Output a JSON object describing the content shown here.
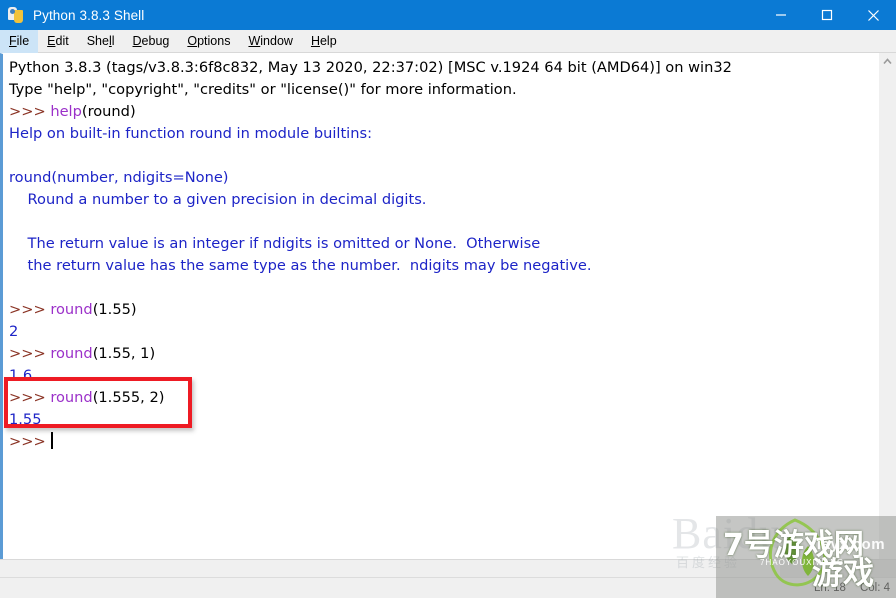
{
  "window": {
    "title": "Python 3.8.3 Shell",
    "icon": "python-logo-icon",
    "minimize_label": "—",
    "maximize_label": "□",
    "close_label": "✕"
  },
  "menubar": {
    "items": [
      {
        "label": "File",
        "accel": "F",
        "active": true
      },
      {
        "label": "Edit",
        "accel": "E",
        "active": false
      },
      {
        "label": "Shell",
        "accel": "l",
        "active": false
      },
      {
        "label": "Debug",
        "accel": "D",
        "active": false
      },
      {
        "label": "Options",
        "accel": "O",
        "active": false
      },
      {
        "label": "Window",
        "accel": "W",
        "active": false
      },
      {
        "label": "Help",
        "accel": "H",
        "active": false
      }
    ]
  },
  "console": {
    "lines": [
      {
        "segments": [
          {
            "text": "Python 3.8.3 (tags/v3.8.3:6f8c832, May 13 2020, 22:37:02) [MSC v.1924 64 bit (AMD64)] on win32",
            "style": "plain"
          }
        ]
      },
      {
        "segments": [
          {
            "text": "Type \"help\", \"copyright\", \"credits\" or \"license()\" for more information.",
            "style": "plain"
          }
        ]
      },
      {
        "segments": [
          {
            "text": ">>> ",
            "style": "prompt"
          },
          {
            "text": "help",
            "style": "builtin"
          },
          {
            "text": "(round)",
            "style": "plain"
          }
        ]
      },
      {
        "segments": [
          {
            "text": "Help on built-in function round in module builtins:",
            "style": "help"
          }
        ]
      },
      {
        "segments": [
          {
            "text": "",
            "style": "plain"
          }
        ]
      },
      {
        "segments": [
          {
            "text": "round(number, ndigits=None)",
            "style": "help"
          }
        ]
      },
      {
        "segments": [
          {
            "text": "    Round a number to a given precision in decimal digits.",
            "style": "help"
          }
        ]
      },
      {
        "segments": [
          {
            "text": "",
            "style": "plain"
          }
        ]
      },
      {
        "segments": [
          {
            "text": "    The return value is an integer if ndigits is omitted or None.  Otherwise",
            "style": "help"
          }
        ]
      },
      {
        "segments": [
          {
            "text": "    the return value has the same type as the number.  ndigits may be negative.",
            "style": "help"
          }
        ]
      },
      {
        "segments": [
          {
            "text": "",
            "style": "plain"
          }
        ]
      },
      {
        "segments": [
          {
            "text": ">>> ",
            "style": "prompt"
          },
          {
            "text": "round",
            "style": "builtin"
          },
          {
            "text": "(1.55)",
            "style": "plain"
          }
        ]
      },
      {
        "segments": [
          {
            "text": "2",
            "style": "output"
          }
        ]
      },
      {
        "segments": [
          {
            "text": ">>> ",
            "style": "prompt"
          },
          {
            "text": "round",
            "style": "builtin"
          },
          {
            "text": "(1.55, 1)",
            "style": "plain"
          }
        ]
      },
      {
        "segments": [
          {
            "text": "1.6",
            "style": "output"
          }
        ]
      },
      {
        "segments": [
          {
            "text": ">>> ",
            "style": "prompt"
          },
          {
            "text": "round",
            "style": "builtin"
          },
          {
            "text": "(1.555, 2)",
            "style": "plain"
          }
        ]
      },
      {
        "segments": [
          {
            "text": "1.55",
            "style": "output"
          }
        ]
      },
      {
        "segments": [
          {
            "text": ">>> ",
            "style": "prompt"
          }
        ],
        "caret": true
      }
    ],
    "colors": {
      "prompt": "#8a3324",
      "builtin": "#9b30c9",
      "output": "#1d24c7",
      "help": "#1d24c7",
      "plain": "#000000"
    }
  },
  "annotation": {
    "type": "red-rectangle-highlight",
    "targets": ">>> round(1.555, 2) / 1.55",
    "color": "#ee1b24"
  },
  "statusbar": {
    "line_label": "Ln: 18",
    "col_label": "Col: 4"
  },
  "watermark": {
    "baidu": "Baidu",
    "baidu_sub": "百度经验",
    "brand_cn": "7号游戏网",
    "brand_cn2": "游戏",
    "pinyin": "7HAOYOUXIWANG",
    "site": "xiayx.com"
  },
  "theme": {
    "titlebar_bg": "#0b7ad4",
    "menubar_bg": "#f0f0f0",
    "menu_active_bg": "#cce4f7",
    "text_bg": "#ffffff",
    "text_border": "#5b9bd5",
    "scrollbar_bg": "#f0f0f0"
  }
}
